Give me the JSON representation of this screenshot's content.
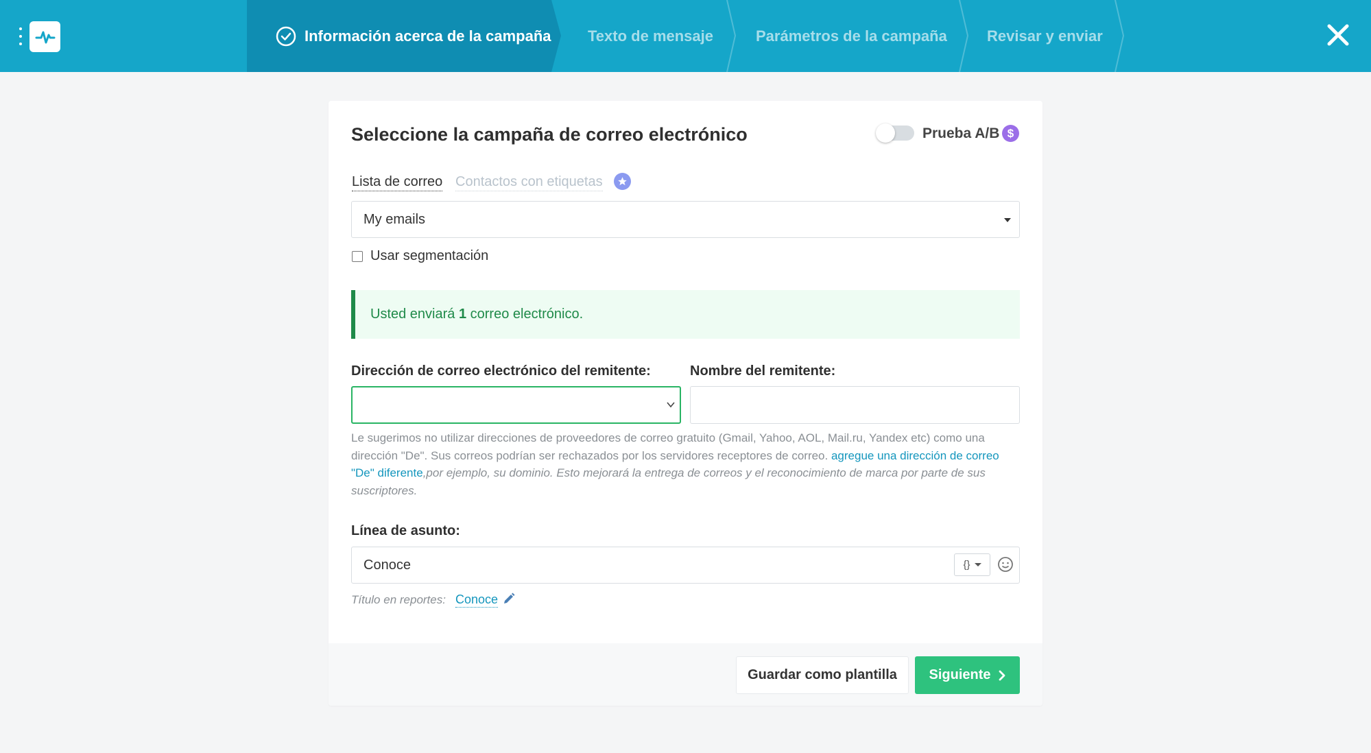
{
  "header": {
    "steps": [
      {
        "label": "Información acerca de la campaña",
        "state": "active",
        "icon": "check-circle-icon"
      },
      {
        "label": "Texto de mensaje",
        "state": "inactive"
      },
      {
        "label": "Parámetros de la campaña",
        "state": "inactive"
      },
      {
        "label": "Revisar y enviar",
        "state": "inactive"
      }
    ],
    "logo_icon": "pulse-icon",
    "close_icon": "close-icon",
    "colors": {
      "bar": "#15a6c9",
      "active_step": "#0f8db2"
    }
  },
  "card": {
    "title": "Seleccione la campaña de correo electrónico",
    "ab_test": {
      "label": "Prueba A/B",
      "enabled": false,
      "badge": "$"
    },
    "tabs": {
      "mail_list": "Lista de correo",
      "tagged_contacts": "Contactos con etiquetas"
    },
    "mail_list_select": {
      "value": "My emails"
    },
    "segmentation": {
      "label": "Usar segmentación",
      "checked": false
    },
    "notice": {
      "prefix": "Usted enviará ",
      "count": "1",
      "suffix": " correo electrónico."
    },
    "sender_email": {
      "label": "Dirección de correo electrónico del remitente:",
      "value": ""
    },
    "sender_name": {
      "label": "Nombre del remitente:",
      "value": ""
    },
    "hint": {
      "text1": "Le sugerimos no utilizar direcciones de proveedores de correo gratuito (Gmail, Yahoo, AOL, Mail.ru, Yandex etc) como una dirección \"De\". Sus correos podrían ser rechazados por los servidores receptores de correo. ",
      "link": "agregue una dirección de correo \"De\" diferente",
      "text2": ",por ejemplo, su dominio. Esto mejorará la entrega de correos y el reconocimiento de marca por parte de sus suscriptores."
    },
    "subject": {
      "label": "Línea de asunto:",
      "value": "Conoce",
      "var_button": "{}"
    },
    "report_title": {
      "label": "Título en reportes:",
      "value": "Conoce"
    }
  },
  "footer": {
    "save_template": "Guardar como plantilla",
    "next": "Siguiente"
  }
}
